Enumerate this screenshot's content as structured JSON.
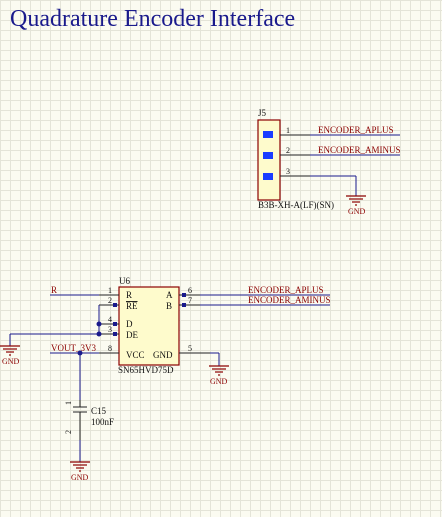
{
  "title": "Quadrature Encoder Interface",
  "connector": {
    "designator": "J5",
    "part": "B3B-XH-A(LF)(SN)",
    "pins": [
      "1",
      "2",
      "3"
    ],
    "nets": [
      "ENCODER_APLUS",
      "ENCODER_AMINUS"
    ],
    "gnd": "GND"
  },
  "ic": {
    "designator": "U6",
    "part": "SN65HVD75D",
    "pin_names": {
      "R": "R",
      "RE": "RE",
      "D": "D",
      "DE": "DE",
      "VCC": "VCC",
      "GND": "GND",
      "A": "A",
      "B": "B"
    },
    "pin_numbers": {
      "R": "1",
      "RE": "2",
      "D": "4",
      "DE": "3",
      "VCC": "8",
      "GND": "5",
      "A": "6",
      "B": "7"
    },
    "nets": {
      "r_in": "R",
      "vout": "VOUT_3V3",
      "a_out": "ENCODER_APLUS",
      "b_out": "ENCODER_AMINUS"
    },
    "gnd_left": "GND",
    "gnd_right": "GND"
  },
  "capacitor": {
    "designator": "C15",
    "value": "100nF",
    "pins": [
      "1",
      "2"
    ],
    "gnd": "GND"
  }
}
